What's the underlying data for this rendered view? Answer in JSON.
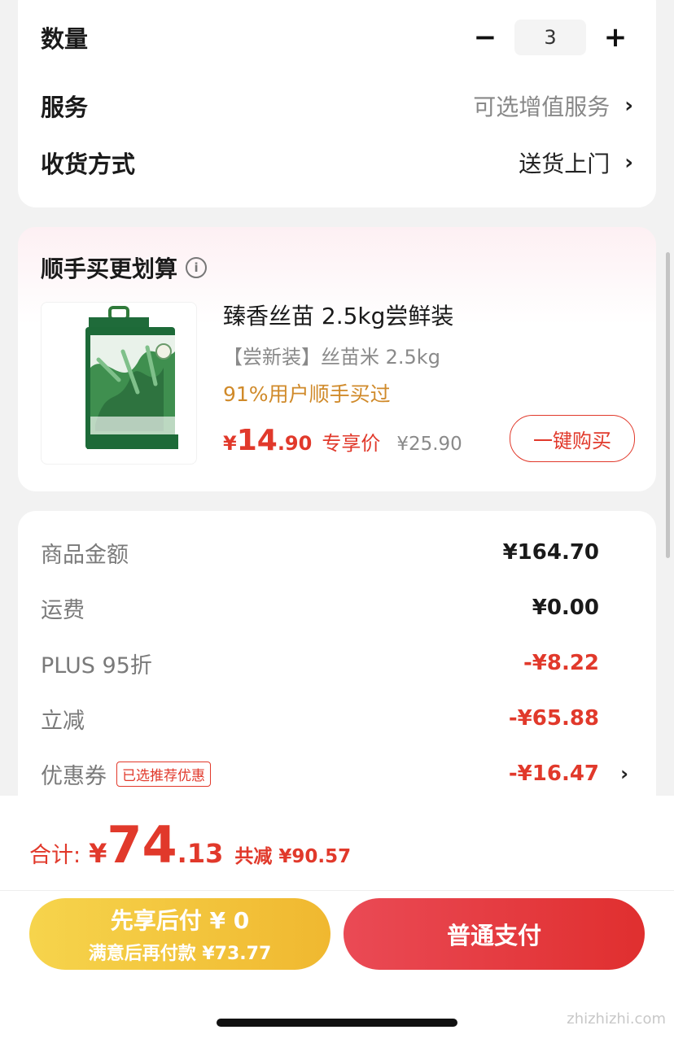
{
  "options": {
    "quantity_label": "数量",
    "quantity_value": "3",
    "minus_symbol": "−",
    "plus_symbol": "+",
    "service_label": "服务",
    "service_value": "可选增值服务",
    "delivery_label": "收货方式",
    "delivery_value": "送货上门"
  },
  "addon": {
    "title": "顺手买更划算",
    "info_icon": "i",
    "product": {
      "name": "臻香丝苗 2.5kg尝鲜装",
      "subtitle": "【尝新装】丝苗米 2.5kg",
      "popularity": "91%用户顺手买过",
      "currency": "¥",
      "price_int": "14",
      "price_dec": ".90",
      "price_tag": "专享价",
      "original_price": "¥25.90",
      "buy_label": "一键购买"
    }
  },
  "summary": {
    "rows": [
      {
        "label": "商品金额",
        "value": "¥164.70"
      },
      {
        "label": "运费",
        "value": "¥0.00"
      },
      {
        "label": "PLUS 95折",
        "value": "-¥8.22"
      },
      {
        "label": "立减",
        "value": "-¥65.88"
      },
      {
        "label": "优惠券",
        "value": "-¥16.47",
        "badge": "已选推荐优惠"
      }
    ]
  },
  "footer": {
    "total_label": "合计:",
    "currency": "¥",
    "total_int": "74",
    "total_dec": ".13",
    "saved_text": "共减 ¥90.57",
    "pay_later_main": "先享后付 ¥ 0",
    "pay_later_sub": "满意后再付款 ¥73.77",
    "pay_normal_label": "普通支付",
    "watermark": "zhizhizhi.com"
  },
  "colors": {
    "accent_red": "#e1392b",
    "gold": "#f0b830",
    "popularity_orange": "#d08a2a"
  },
  "icons": {
    "chevron": "chevron-right-icon",
    "info": "info-icon",
    "product_image": "rice-bag-image"
  }
}
